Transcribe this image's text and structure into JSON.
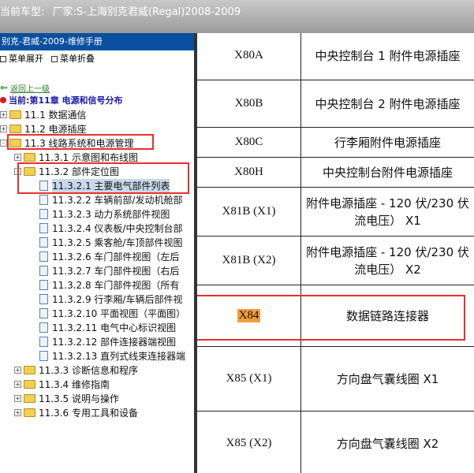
{
  "header": {
    "vehicle_label": "当前车型:",
    "vehicle_value": "厂家:S-上海别克君威(Regal)2008-2009"
  },
  "left_panel": {
    "title": "别克-君威-2009-维修手册",
    "tools": {
      "expand_label": "菜单展开",
      "collapse_label": "菜单折叠"
    },
    "back_label": "返回上一级",
    "current_label": "当前:第11章 电源和信号分布",
    "tree": [
      {
        "label": "11.1 数据通信",
        "type": "folder",
        "expander": "+",
        "level": 0
      },
      {
        "label": "11.2 电源插座",
        "type": "folder",
        "expander": "+",
        "level": 0
      },
      {
        "label": "11.3 线路系统和电源管理",
        "type": "folder",
        "expander": "-",
        "level": 0
      },
      {
        "label": "11.3.1 示意图和布线图",
        "type": "folder",
        "expander": "+",
        "level": 1
      },
      {
        "label": "11.3.2 部件定位图",
        "type": "folder",
        "expander": "-",
        "level": 1
      },
      {
        "label": "11.3.2.1 主要电气部件列表",
        "type": "doc",
        "level": 2,
        "selected": true
      },
      {
        "label": "11.3.2.2 车辆前部/发动机舱部",
        "type": "doc",
        "level": 2
      },
      {
        "label": "11.3.2.3 动力系统部件视图",
        "type": "doc",
        "level": 2
      },
      {
        "label": "11.3.2.4 仪表板/中央控制台部",
        "type": "doc",
        "level": 2
      },
      {
        "label": "11.3.2.5 乘客舱/车顶部件视图",
        "type": "doc",
        "level": 2
      },
      {
        "label": "11.3.2.6 车门部件视图（左后",
        "type": "doc",
        "level": 2
      },
      {
        "label": "11.3.2.7 车门部件视图（右后",
        "type": "doc",
        "level": 2
      },
      {
        "label": "11.3.2.8 车门部件视图（所有",
        "type": "doc",
        "level": 2
      },
      {
        "label": "11.3.2.9 行李厢/车辆后部件视",
        "type": "doc",
        "level": 2
      },
      {
        "label": "11.3.2.10 平面视图（平面图）",
        "type": "doc",
        "level": 2
      },
      {
        "label": "11.3.2.11 电气中心标识视图",
        "type": "doc",
        "level": 2
      },
      {
        "label": "11.3.2.12 部件连接器端视图",
        "type": "doc",
        "level": 2
      },
      {
        "label": "11.3.2.13 直列式线束连接器端",
        "type": "doc",
        "level": 2
      },
      {
        "label": "11.3.3 诊断信息和程序",
        "type": "folder",
        "expander": "+",
        "level": 1
      },
      {
        "label": "11.3.4 维修指南",
        "type": "folder",
        "expander": "+",
        "level": 1
      },
      {
        "label": "11.3.5 说明与操作",
        "type": "folder",
        "expander": "+",
        "level": 1
      },
      {
        "label": "11.3.6 专用工具和设备",
        "type": "folder",
        "expander": "+",
        "level": 1
      }
    ]
  },
  "table": {
    "rows": [
      {
        "code": "X80A",
        "desc": "中央控制台 1 附件电源插座"
      },
      {
        "code": "X80B",
        "desc": "中央控制台 2 附件电源插座"
      },
      {
        "code": "X80C",
        "desc": "行李厢附件电源插座"
      },
      {
        "code": "X80H",
        "desc": "中央控制台附件电源插座"
      },
      {
        "code": "X81B (X1)",
        "desc": "附件电源插座 - 120 伏/230 伏流电压） X1"
      },
      {
        "code": "X81B (X2)",
        "desc": "附件电源插座 - 120 伏/230 伏流电压） X2"
      },
      {
        "code": "X84",
        "desc": "数据链路连接器",
        "highlight": true
      },
      {
        "code": "X85 (X1)",
        "desc": "方向盘气囊线圈 X1"
      },
      {
        "code": "X85 (X2)",
        "desc": "方向盘气囊线圈 X2"
      }
    ]
  },
  "colors": {
    "highlight_border": "#e53030",
    "code_highlight": "#f39c3c",
    "panel_header": "#0a4fa0"
  }
}
